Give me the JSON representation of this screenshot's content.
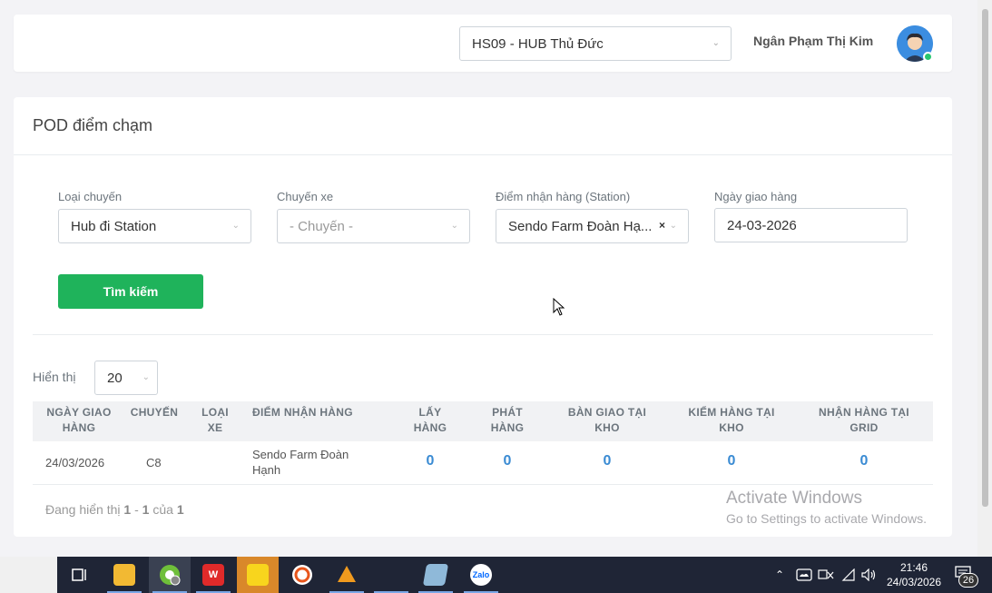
{
  "header": {
    "hub_select_value": "HS09 - HUB Thủ Đức",
    "user_name": "Ngân Phạm Thị Kim"
  },
  "page": {
    "title": "POD điểm chạm"
  },
  "filters": {
    "trip_type": {
      "label": "Loại chuyến",
      "value": "Hub đi Station"
    },
    "trip": {
      "label": "Chuyến xe",
      "placeholder": "- Chuyến -"
    },
    "station": {
      "label": "Điểm nhận hàng (Station)",
      "value": "Sendo Farm Đoàn Hạ...",
      "clear": "×"
    },
    "date": {
      "label": "Ngày giao hàng",
      "value": "24-03-2026"
    },
    "search_label": "Tìm kiếm"
  },
  "table": {
    "show_label": "Hiển thị",
    "page_size": "20",
    "headers": {
      "date": [
        "NGÀY GIAO",
        "HÀNG"
      ],
      "trip": [
        "CHUYẾN"
      ],
      "vehicle": [
        "LOẠI",
        "XE"
      ],
      "point": [
        "ĐIỂM NHẬN HÀNG"
      ],
      "pickup": [
        "LẤY",
        "HÀNG"
      ],
      "deliver": [
        "PHÁT",
        "HÀNG"
      ],
      "handover": [
        "BÀN GIAO TẠI",
        "KHO"
      ],
      "check": [
        "KIỂM HÀNG TẠI",
        "KHO"
      ],
      "receive": [
        "NHẬN HÀNG TẠI",
        "GRID"
      ]
    },
    "rows": [
      {
        "date": "24/03/2026",
        "trip": "C8",
        "vehicle": "",
        "point_line1": "Sendo Farm Đoàn",
        "point_line2": "Hạnh",
        "pickup": "0",
        "deliver": "0",
        "handover": "0",
        "check": "0",
        "receive": "0"
      }
    ],
    "footer": {
      "prefix": "Đang hiển thị",
      "from": "1",
      "dash": "-",
      "to": "1",
      "of": "của",
      "total": "1"
    }
  },
  "watermark": {
    "line1": "Activate Windows",
    "line2": "Go to Settings to activate Windows."
  },
  "taskbar": {
    "apps": [
      "task-view-icon",
      "file-explorer-icon",
      "chrome-profile-icon",
      "wps-icon",
      "sticky-notes-icon",
      "app-o-icon",
      "app-orange-icon",
      "app-blank",
      "notepad-icon",
      "zalo-icon"
    ],
    "zalo_text": "Zalo",
    "time": "21:46",
    "date": "24/03/2026",
    "notifications": "26"
  },
  "colors": {
    "primary_green": "#1fb35b",
    "link_blue": "#3a8bd3",
    "online_green": "#28c76f"
  }
}
